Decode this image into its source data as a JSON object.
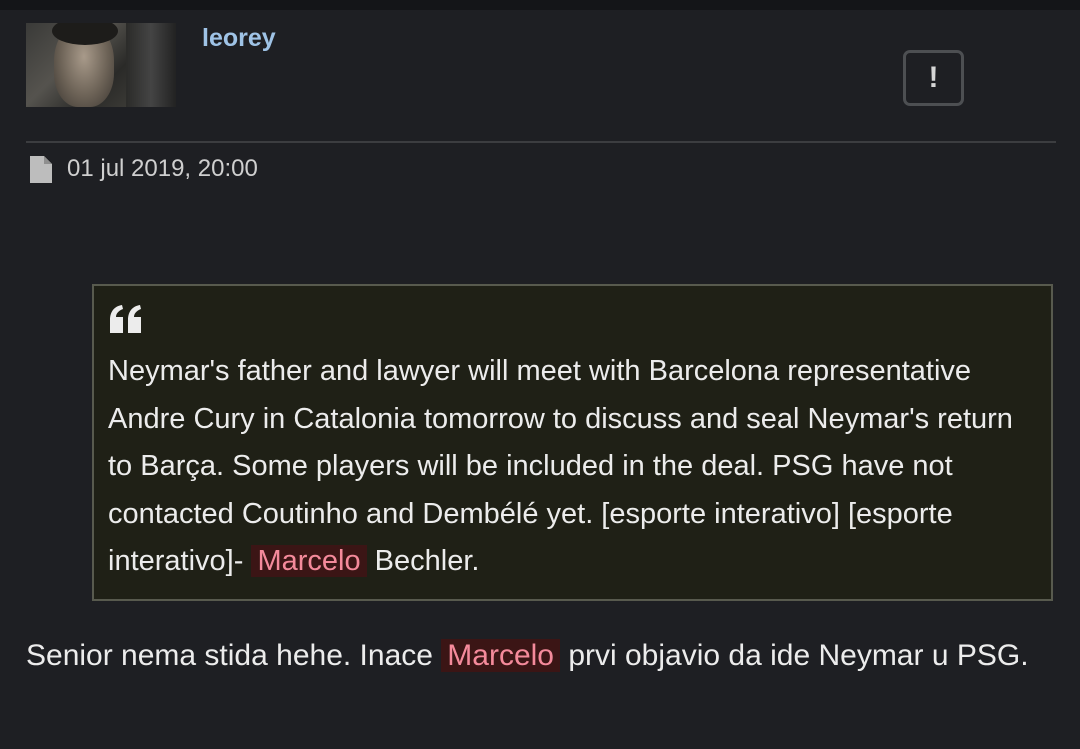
{
  "post": {
    "username": "leorey",
    "report_label": "!",
    "date": "01 jul 2019, 20:00",
    "icons": {
      "report": "exclamation-icon",
      "post": "document-icon",
      "quote": "quote-icon"
    }
  },
  "quote": {
    "text_before": "Neymar's father and lawyer will meet with Barcelona representative Andre Cury in Catalonia tomorrow to discuss and seal Neymar's return to Barça. Some players will be included in the deal. PSG have not contacted Coutinho and Dembélé yet. [esporte interativo] [esporte interativo]- ",
    "highlight": "Marcelo",
    "text_after": " Bechler."
  },
  "comment": {
    "text_before": "Senior nema stida hehe. Inace ",
    "highlight": "Marcelo",
    "text_after": " prvi objavio da ide Neymar u PSG."
  },
  "colors": {
    "background": "#1e1f23",
    "username": "#9fc3e6",
    "quote_background": "#1f2016",
    "highlight_text": "#f48a9b",
    "highlight_background": "#3b1515"
  }
}
